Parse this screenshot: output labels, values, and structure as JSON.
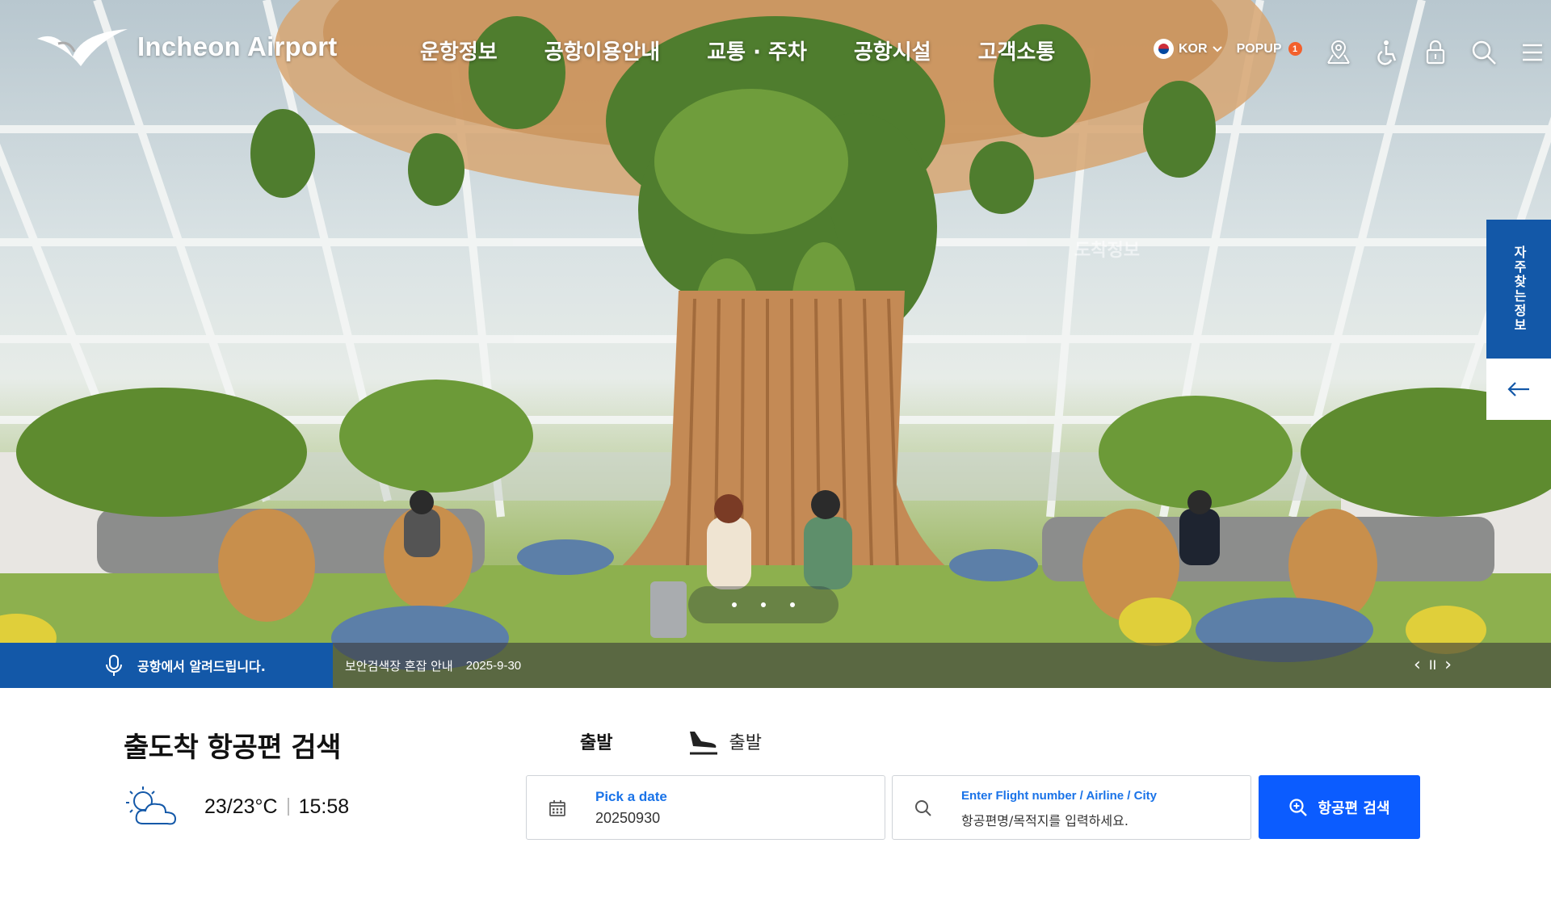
{
  "header": {
    "logo_text": "Incheon Airport",
    "nav": [
      "운항정보",
      "공항이용안내",
      "교통 · 주차",
      "공항시설",
      "고객소통"
    ],
    "language": "KOR",
    "popup_label": "POPUP",
    "popup_count": "1",
    "icons": [
      "map-icon",
      "accessibility-icon",
      "lock-icon",
      "search-icon",
      "menu-icon"
    ]
  },
  "hero": {
    "ghost_text": "도착정보",
    "quick_panel_label": "자주찾는정보",
    "slide_count": 3
  },
  "notice": {
    "label": "공항에서 알려드립니다.",
    "title": "보안검색장 혼잡 안내",
    "date": "2025-9-30",
    "prev": "‹",
    "pause": "II",
    "next": "›"
  },
  "flight_search": {
    "title": "출도착 항공편 검색",
    "weather_temp": "23/23°C",
    "weather_time": "15:58",
    "tab_departure": "출발",
    "tab_arrival": "출발",
    "date_label": "Pick a date",
    "date_value": "20250930",
    "flight_label": "Enter Flight number / Airline / City",
    "flight_placeholder": "항공편명/목적지를 입력하세요.",
    "search_button": "항공편 검색"
  },
  "colors": {
    "brand_blue": "#1358a8",
    "button_blue": "#0b5cff",
    "label_blue": "#1a73e8",
    "badge_orange": "#f3602c"
  }
}
